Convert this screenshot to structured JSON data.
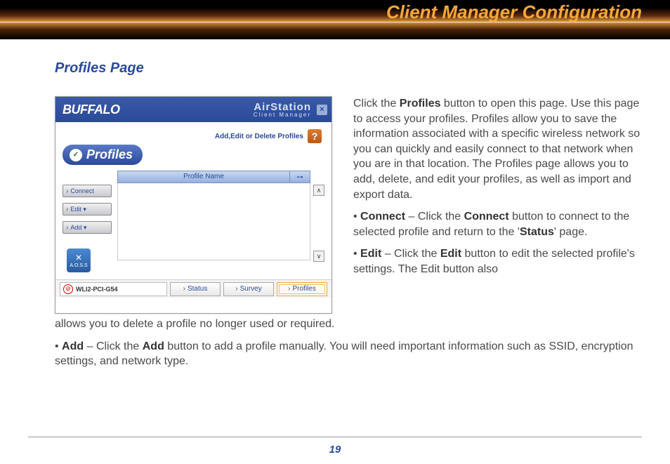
{
  "header": {
    "title": "Client Manager Configuration"
  },
  "section": {
    "title": "Profiles Page"
  },
  "app": {
    "brand": "BUFFALO",
    "sub_brand": "AirStation",
    "sub_brand_line": "Client Manager",
    "close": "×",
    "subtitle": "Add,Edit or Delete Profiles",
    "help": "?",
    "pill_symbol": "✓",
    "pill_label": "Profiles",
    "sidebar": {
      "connect": "Connect",
      "edit": "Edit  ▾",
      "add": "Add  ▾"
    },
    "table": {
      "header_name": "Profile Name",
      "header_lock": "⊶"
    },
    "scroll": {
      "up": "∧",
      "down": "∨"
    },
    "aoss": {
      "symbol": "✕",
      "label": "A.O.S.S"
    },
    "adapter": {
      "icon": "⊘",
      "name": "WLI2-PCI-G54"
    },
    "tabs": {
      "status": "Status",
      "survey": "Survey",
      "profiles": "Profiles"
    }
  },
  "text": {
    "p1_a": "Click the ",
    "p1_b": "Profiles",
    "p1_c": " button to open this page. Use this page to access your profiles. Profiles allow you to save the information associated with a specific wireless network so you can quickly and easily connect to that network when you are in that location. The Profiles page allows you to add, delete, and edit your profiles, as well as import and export data.",
    "p2_a": "• ",
    "p2_b": "Connect",
    "p2_c": " – Click the ",
    "p2_d": "Connect",
    "p2_e": " button to connect to the selected profile and return to the '",
    "p2_f": "Status",
    "p2_g": "' page.",
    "p3_a": "• ",
    "p3_b": "Edit",
    "p3_c": " – Click the ",
    "p3_d": "Edit",
    "p3_e": " button to edit the selected profile's settings.  The Edit button also ",
    "p3_cont": "allows you to delete a profile no longer used or required.",
    "p4_a": "• ",
    "p4_b": "Add",
    "p4_c": " – Click the ",
    "p4_d": "Add",
    "p4_e": " button to add a profile manually.  You will need important information such as SSID, encryption settings, and network type."
  },
  "footer": {
    "page": "19"
  }
}
